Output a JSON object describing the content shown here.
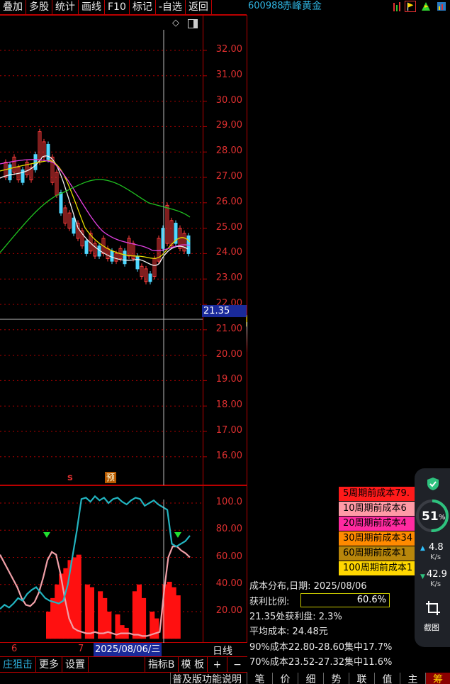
{
  "toolbar": {
    "items": [
      "叠加",
      "多股",
      "统计",
      "画线",
      "F10",
      "标记",
      "-自选",
      "返回"
    ]
  },
  "stock": {
    "code": "600988",
    "name": "赤峰黄金"
  },
  "main_chart": {
    "price_ticks": [
      "32.00",
      "31.00",
      "30.00",
      "29.00",
      "28.00",
      "27.00",
      "26.00",
      "25.00",
      "24.00",
      "23.00",
      "22.00",
      "21.00",
      "20.00",
      "19.00",
      "18.00",
      "17.00",
      "16.00"
    ],
    "current_price_label": "21.35",
    "diamond_icon": "diamond-icon",
    "toggle_icon": "panel-toggle-icon"
  },
  "indicator_chart": {
    "ticks": [
      "100.0",
      "80.00",
      "60.00",
      "40.00",
      "20.00"
    ],
    "signal_s": "s",
    "signal_yu": "预",
    "cyan_series": [
      22,
      25,
      23,
      26,
      30,
      28,
      33,
      36,
      38,
      34,
      30,
      28,
      27,
      26,
      28,
      40,
      60,
      80,
      103,
      104,
      101,
      105,
      102,
      104,
      100,
      103,
      104,
      101,
      99,
      102,
      104,
      103,
      98,
      100,
      102,
      99,
      97,
      95,
      70,
      68,
      70,
      72,
      76
    ],
    "pink_series": [
      62,
      56,
      50,
      44,
      38,
      30,
      25,
      24,
      27,
      34,
      45,
      58,
      64,
      62,
      48,
      30,
      15,
      8,
      6,
      5,
      4,
      4,
      5,
      4,
      4,
      5,
      4,
      3,
      4,
      4,
      4,
      3,
      3,
      2,
      2,
      3,
      4,
      5,
      35,
      60,
      68,
      68,
      65,
      63,
      60
    ],
    "bar_heights": [
      0,
      0,
      0,
      0,
      0,
      0,
      0,
      0,
      0,
      0,
      0,
      20,
      30,
      40,
      48,
      52,
      58,
      60,
      62,
      0,
      40,
      38,
      0,
      35,
      30,
      20,
      0,
      18,
      10,
      8,
      0,
      35,
      40,
      30,
      0,
      20,
      15,
      0,
      40,
      42,
      38,
      32,
      0,
      0,
      0
    ],
    "markers": [
      "down-triangle",
      "down-triangle"
    ]
  },
  "time_axis": {
    "labels": [
      "6",
      "7"
    ],
    "date": "2025/08/06/三",
    "period": "日线"
  },
  "bottom_bar": {
    "left": [
      "庄狙击",
      "更多",
      "设置"
    ],
    "right": [
      "指标B",
      "模 板",
      "+",
      "−"
    ]
  },
  "tabs": [
    "普及版功能说明",
    "笔",
    "价",
    "细",
    "势",
    "联",
    "值",
    "主",
    "筹"
  ],
  "chip": {
    "legend": [
      {
        "label": "5周期前成本79.",
        "color": "#ff1a1a"
      },
      {
        "label": "10周期前成本6",
        "color": "#ff9aa6"
      },
      {
        "label": "20周期前成本4",
        "color": "#ff2aa0"
      },
      {
        "label": "30周期前成本34",
        "color": "#ff8a00"
      },
      {
        "label": "60周期前成本1",
        "color": "#b8860b"
      },
      {
        "label": "100周期前成本1",
        "color": "#ffd700"
      }
    ],
    "date_line": "成本分布,日期:  2025/08/06",
    "profit_label": "获利比例:",
    "profit_value": "60.6%",
    "profit_ratio": 0.606,
    "profit_at_price": "21.35处获利盘:  2.3%",
    "avg_cost": "平均成本:  24.48元",
    "cost90": "90%成本22.80-28.60集中17.7%",
    "cost70": "70%成本23.52-27.32集中11.6%"
  },
  "widget": {
    "percent": "51",
    "percent_unit": "%",
    "up_speed": "4.8",
    "down_speed": "42.9",
    "speed_unit": "K/s",
    "screenshot_label": "截图",
    "shield_icon": "shield-check-icon",
    "crop_icon": "crop-icon"
  },
  "colors": {
    "grid_red": "#b00000",
    "axis_red": "#e03030",
    "cyan": "#22b4c0",
    "pink_line": "#f0a0a8",
    "bar_red": "#ff1010",
    "profit_border": "#c8c800"
  }
}
